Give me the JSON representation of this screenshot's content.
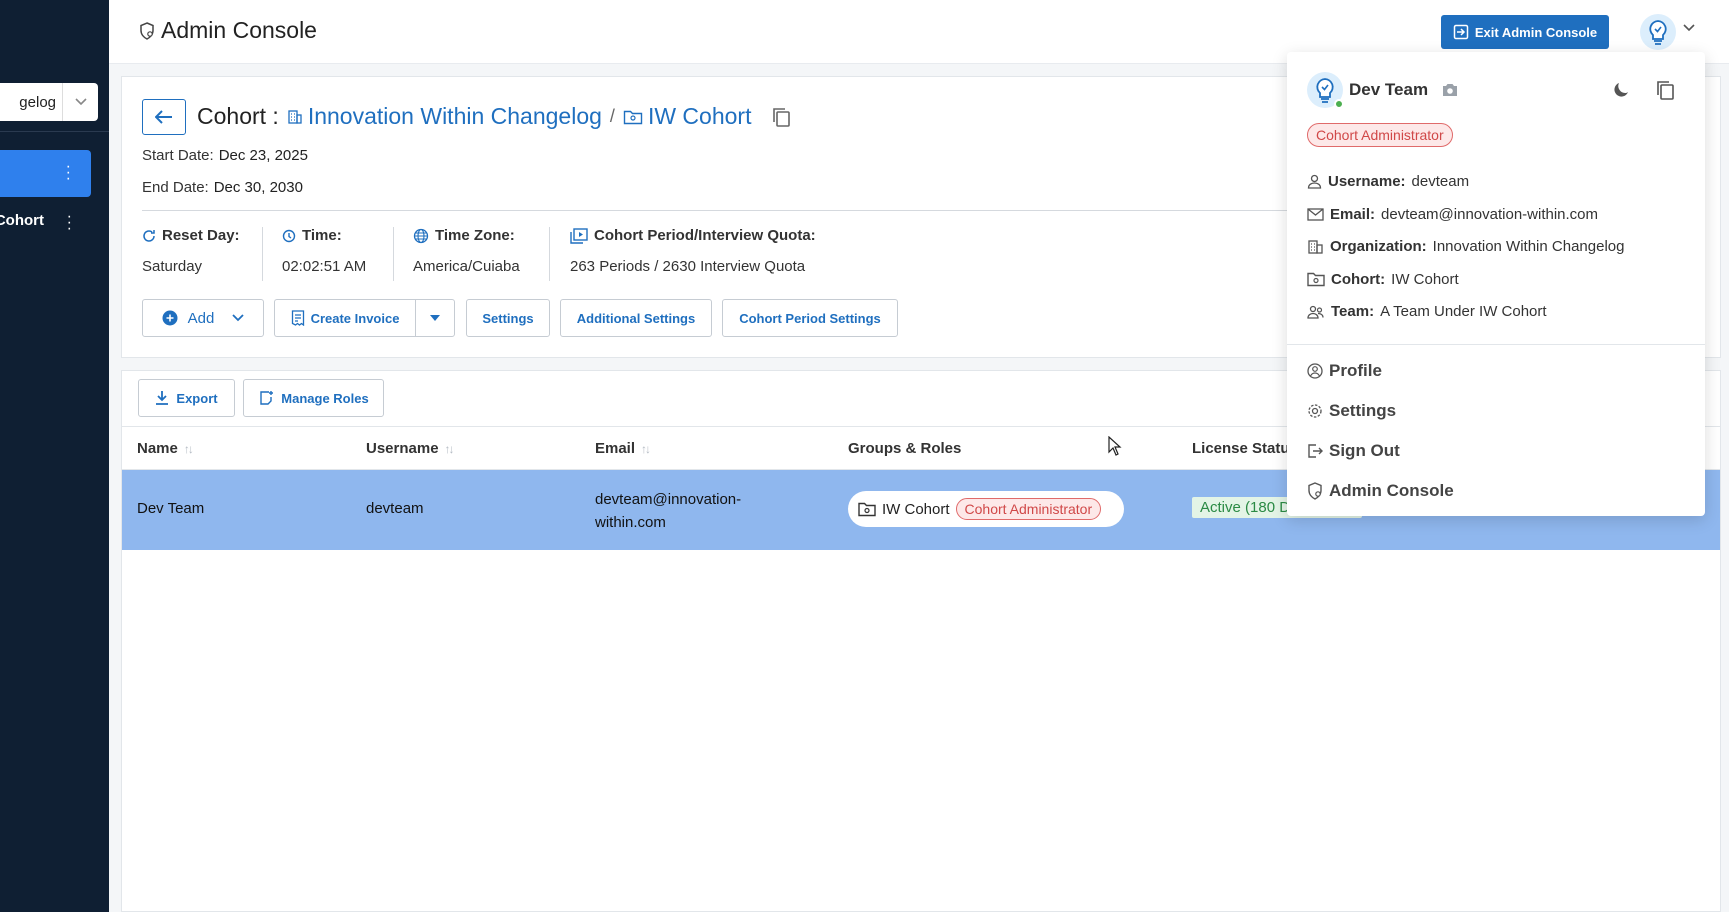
{
  "sidebar": {
    "org_select_value": "gelog",
    "item_label": "Cohort"
  },
  "header": {
    "title": "Admin Console",
    "exit_button": "Exit Admin Console"
  },
  "cohort": {
    "label": "Cohort :",
    "org": "Innovation Within Changelog",
    "separator": "/",
    "cohort_name": "IW Cohort",
    "start_label": "Start Date:",
    "start_value": "Dec 23, 2025",
    "end_label": "End Date:",
    "end_value": "Dec 30, 2030",
    "reset_label": "Reset Day:",
    "reset_value": "Saturday",
    "time_label": "Time:",
    "time_value": "02:02:51 AM",
    "tz_label": "Time Zone:",
    "tz_value": "America/Cuiaba",
    "quota_label": "Cohort Period/Interview Quota:",
    "quota_value": "263 Periods / 2630 Interview Quota"
  },
  "actions": {
    "add": "Add",
    "create_invoice": "Create Invoice",
    "settings": "Settings",
    "additional_settings": "Additional Settings",
    "cohort_period_settings": "Cohort Period Settings"
  },
  "table": {
    "export": "Export",
    "manage_roles": "Manage Roles",
    "columns": [
      "Name",
      "Username",
      "Email",
      "Groups & Roles",
      "License Statu"
    ],
    "rows": [
      {
        "name": "Dev Team",
        "username": "devteam",
        "email_line1": "devteam@innovation-",
        "email_line2": "within.com",
        "group": "IW Cohort",
        "role": "Cohort Administrator",
        "license": "Active (180 D"
      }
    ]
  },
  "dropdown": {
    "name": "Dev Team",
    "role_badge": "Cohort Administrator",
    "fields": [
      {
        "label": "Username:",
        "value": "devteam"
      },
      {
        "label": "Email:",
        "value": "devteam@innovation-within.com"
      },
      {
        "label": "Organization:",
        "value": "Innovation Within Changelog"
      },
      {
        "label": "Cohort:",
        "value": "IW Cohort"
      },
      {
        "label": "Team:",
        "value": "A Team Under IW Cohort"
      }
    ],
    "menu": [
      "Profile",
      "Settings",
      "Sign Out",
      "Admin Console"
    ]
  },
  "colors": {
    "sidebar_bg": "#0f1f33",
    "primary": "#1f6fbf",
    "selected_row": "#8fb7ee",
    "badge_red": "#d04848",
    "license_green": "#2a8a44"
  }
}
